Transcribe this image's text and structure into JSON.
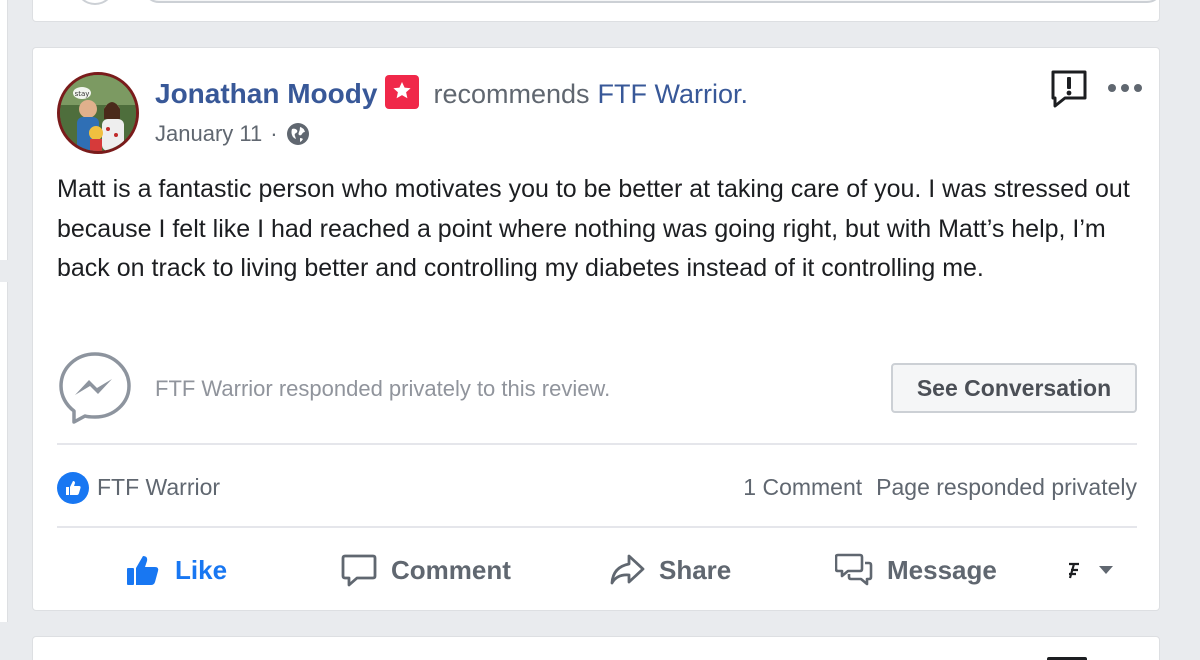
{
  "post": {
    "author": "Jonathan Moody",
    "verb": "recommends",
    "page_name": "FTF Warrior.",
    "date": "January 11",
    "separator": "·",
    "body": "Matt is a fantastic person who motivates you to be better at taking care of you. I was stressed out because I felt like I had reached a point where nothing was going right, but with Matt’s help, I’m back on track to living better and controlling my diabetes instead of it controlling me.",
    "avatar_caption": "stay"
  },
  "response": {
    "text": "FTF Warrior responded privately to this review.",
    "button_label": "See Conversation"
  },
  "stats": {
    "liker": "FTF Warrior",
    "comments": "1 Comment",
    "page_response": "Page responded privately"
  },
  "actions": {
    "like": "Like",
    "comment": "Comment",
    "share": "Share",
    "message": "Message"
  },
  "icons": {
    "recommendation": "recommend-badge-icon",
    "privacy": "globe-icon",
    "report": "report-icon",
    "more": "more-options-icon",
    "messenger": "messenger-icon",
    "like_badge": "like-badge-icon",
    "like": "thumbs-up-icon",
    "comment": "comment-bubble-icon",
    "share": "share-arrow-icon",
    "message": "message-bubbles-icon",
    "actor": "actor-selector-icon",
    "dropdown": "caret-down-icon"
  },
  "colors": {
    "link_blue": "#385898",
    "like_blue": "#1877f2",
    "badge_red": "#f02849",
    "muted_text": "#606770",
    "background": "#e9ebee"
  }
}
